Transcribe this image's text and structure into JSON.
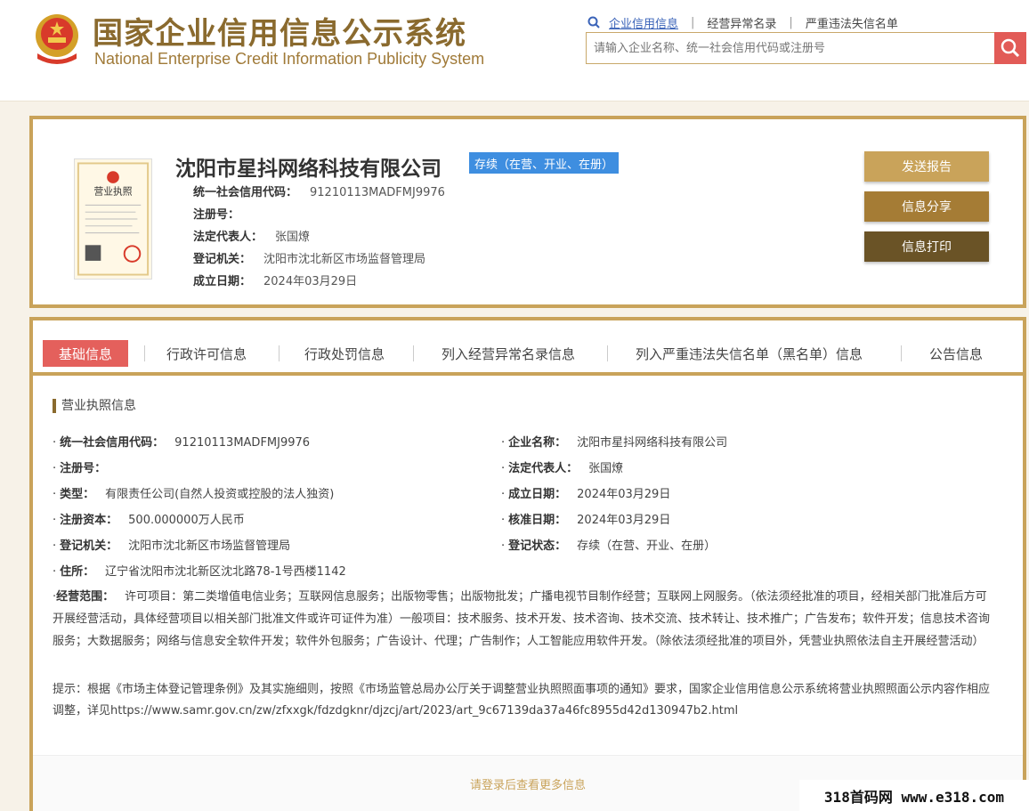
{
  "header": {
    "title_cn": "国家企业信用信息公示系统",
    "title_en": "National Enterprise Credit Information Publicity System",
    "links": [
      "企业信用信息",
      "经营异常名录",
      "严重违法失信名单"
    ],
    "search_placeholder": "请输入企业名称、统一社会信用代码或注册号",
    "icons": {
      "emblem": "national-emblem-icon",
      "search": "search-icon"
    }
  },
  "company": {
    "name": "沈阳市星抖网络科技有限公司",
    "status": "存续（在营、开业、在册）",
    "fields": [
      {
        "label": "统一社会信用代码：",
        "value": "91210113MADFMJ9976"
      },
      {
        "label": "注册号：",
        "value": ""
      },
      {
        "label": "法定代表人：",
        "value": "张国燎"
      },
      {
        "label": "登记机关：",
        "value": "沈阳市沈北新区市场监督管理局"
      },
      {
        "label": "成立日期：",
        "value": "2024年03月29日"
      }
    ],
    "buttons": [
      "发送报告",
      "信息分享",
      "信息打印"
    ],
    "colors": {
      "badge": "#3e8ee0",
      "btn1": "#c9a35a",
      "btn2": "#a57c35",
      "btn3": "#6a5326"
    }
  },
  "tabs": [
    "基础信息",
    "行政许可信息",
    "行政处罚信息",
    "列入经营异常名录信息",
    "列入严重违法失信名单（黑名单）信息",
    "公告信息"
  ],
  "license": {
    "section_title": "营业执照信息",
    "left": [
      {
        "label": "统一社会信用代码：",
        "value": "91210113MADFMJ9976"
      },
      {
        "label": "注册号：",
        "value": ""
      },
      {
        "label": "类型：",
        "value": "有限责任公司(自然人投资或控股的法人独资)"
      },
      {
        "label": "注册资本：",
        "value": "500.000000万人民币"
      },
      {
        "label": "登记机关：",
        "value": "沈阳市沈北新区市场监督管理局"
      },
      {
        "label": "住所：",
        "value": "辽宁省沈阳市沈北新区沈北路78-1号西楼1142"
      }
    ],
    "right": [
      {
        "label": "企业名称：",
        "value": "沈阳市星抖网络科技有限公司"
      },
      {
        "label": "法定代表人：",
        "value": "张国燎"
      },
      {
        "label": "成立日期：",
        "value": "2024年03月29日"
      },
      {
        "label": "核准日期：",
        "value": "2024年03月29日"
      },
      {
        "label": "登记状态：",
        "value": "存续（在营、开业、在册）"
      }
    ],
    "scope_label": "经营范围：",
    "scope_value": "许可项目：第二类增值电信业务；互联网信息服务；出版物零售；出版物批发；广播电视节目制作经营；互联网上网服务。（依法须经批准的项目，经相关部门批准后方可开展经营活动，具体经营项目以相关部门批准文件或许可证件为准）一般项目：技术服务、技术开发、技术咨询、技术交流、技术转让、技术推广；广告发布；软件开发；信息技术咨询服务；大数据服务；网络与信息安全软件开发；软件外包服务；广告设计、代理；广告制作；人工智能应用软件开发。（除依法须经批准的项目外，凭营业执照依法自主开展经营活动）",
    "notice": "提示：根据《市场主体登记管理条例》及其实施细则，按照《市场监管总局办公厅关于调整营业执照照面事项的通知》要求，国家企业信用信息公示系统将营业执照照面公示内容作相应调整，详见https://www.samr.gov.cn/zw/zfxxgk/fdzdgknr/djzcj/art/2023/art_9c67139da37a46fc8955d42d130947b2.html"
  },
  "login_hint": "请登录后查看更多信息",
  "watermark": "318首码网 www.e318.com"
}
